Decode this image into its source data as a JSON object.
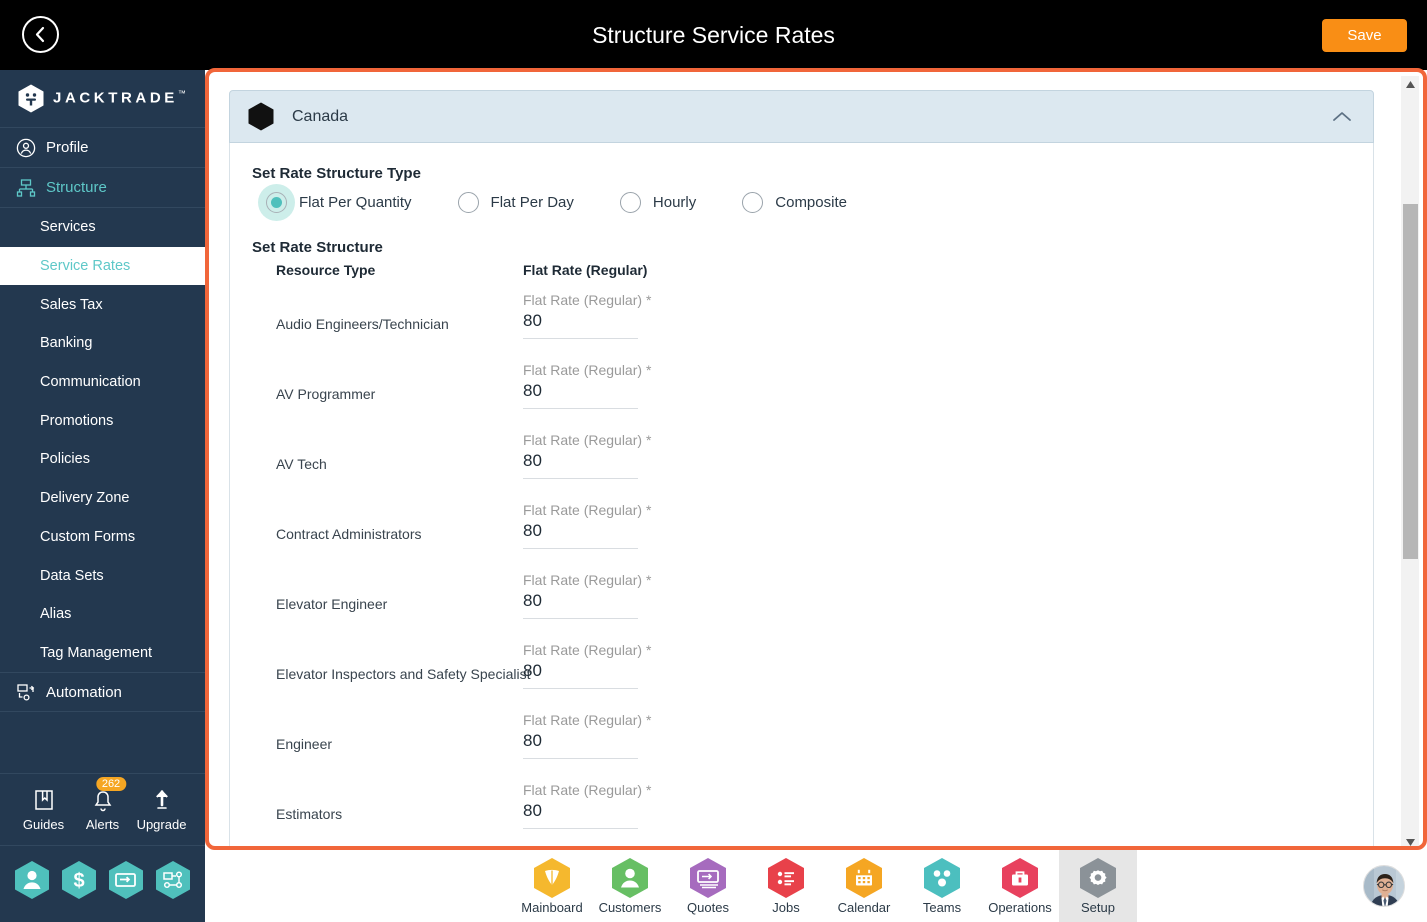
{
  "topbar": {
    "back_icon": "chevron-left-circle-icon",
    "title": "Structure Service Rates",
    "save_label": "Save"
  },
  "sidebar": {
    "brand": "JACKTRADE",
    "brand_tm": "™",
    "brand_icon": "jacktrade-hex-logo",
    "top_items": [
      {
        "label": "Profile",
        "icon": "user-circle-icon",
        "active": false
      },
      {
        "label": "Structure",
        "icon": "org-chart-icon",
        "active": true
      }
    ],
    "sub_items": [
      {
        "label": "Services",
        "active": false
      },
      {
        "label": "Service Rates",
        "active": true
      },
      {
        "label": "Sales Tax",
        "active": false
      },
      {
        "label": "Banking",
        "active": false
      },
      {
        "label": "Communication",
        "active": false
      },
      {
        "label": "Promotions",
        "active": false
      },
      {
        "label": "Policies",
        "active": false
      },
      {
        "label": "Delivery Zone",
        "active": false
      },
      {
        "label": "Custom Forms",
        "active": false
      },
      {
        "label": "Data Sets",
        "active": false
      },
      {
        "label": "Alias",
        "active": false
      },
      {
        "label": "Tag Management",
        "active": false
      }
    ],
    "automation": {
      "label": "Automation",
      "icon": "automation-flow-icon"
    },
    "utilities": [
      {
        "label": "Guides",
        "icon": "book-icon",
        "badge": ""
      },
      {
        "label": "Alerts",
        "icon": "bell-icon",
        "badge": "262"
      },
      {
        "label": "Upgrade",
        "icon": "upload-arrow-icon",
        "badge": ""
      }
    ],
    "quick_icons": [
      "person-hex-icon",
      "dollar-hex-icon",
      "money-transfer-hex-icon",
      "workflow-hex-icon"
    ]
  },
  "main": {
    "country": {
      "name": "Canada",
      "flag_icon": "black-hexagon-icon",
      "collapse_icon": "chevron-up-icon"
    },
    "rate_type": {
      "title": "Set Rate Structure Type",
      "options": [
        {
          "label": "Flat Per Quantity",
          "selected": true
        },
        {
          "label": "Flat Per Day",
          "selected": false
        },
        {
          "label": "Hourly",
          "selected": false
        },
        {
          "label": "Composite",
          "selected": false
        }
      ]
    },
    "rate_structure": {
      "title": "Set Rate Structure",
      "columns": [
        "Resource Type",
        "Flat Rate (Regular)"
      ],
      "field_label": "Flat Rate (Regular)",
      "field_required_mark": "*",
      "rows": [
        {
          "resource": "Audio Engineers/Technician",
          "rate": "80"
        },
        {
          "resource": "AV Programmer",
          "rate": "80"
        },
        {
          "resource": "AV Tech",
          "rate": "80"
        },
        {
          "resource": "Contract Administrators",
          "rate": "80"
        },
        {
          "resource": "Elevator Engineer",
          "rate": "80"
        },
        {
          "resource": "Elevator Inspectors and Safety Specialist",
          "rate": "80"
        },
        {
          "resource": "Engineer",
          "rate": "80"
        },
        {
          "resource": "Estimators",
          "rate": "80"
        }
      ]
    },
    "scrollbar": {
      "up_icon": "triangle-up-icon",
      "down_icon": "triangle-down-icon"
    }
  },
  "bottombar": {
    "items": [
      {
        "label": "Mainboard",
        "icon": "mainboard-hex-icon",
        "color": "#f5b82e",
        "active": false
      },
      {
        "label": "Customers",
        "icon": "customers-hex-icon",
        "color": "#67bf64",
        "active": false
      },
      {
        "label": "Quotes",
        "icon": "quotes-hex-icon",
        "color": "#a66bbe",
        "active": false
      },
      {
        "label": "Jobs",
        "icon": "jobs-hex-icon",
        "color": "#e8414a",
        "active": false
      },
      {
        "label": "Calendar",
        "icon": "calendar-hex-icon",
        "color": "#f5a623",
        "active": false
      },
      {
        "label": "Teams",
        "icon": "teams-hex-icon",
        "color": "#4cbfbf",
        "active": false
      },
      {
        "label": "Operations",
        "icon": "operations-hex-icon",
        "color": "#e8415e",
        "active": false
      },
      {
        "label": "Setup",
        "icon": "setup-gear-hex-icon",
        "color": "#8b9298",
        "active": true
      }
    ],
    "avatar_icon": "user-avatar-photo"
  },
  "colors": {
    "accent_orange": "#f1663a",
    "save_orange": "#f98e15",
    "sidebar_navy": "#23384f",
    "teal": "#4fc0bc",
    "country_header_bg": "#dce8f0"
  }
}
